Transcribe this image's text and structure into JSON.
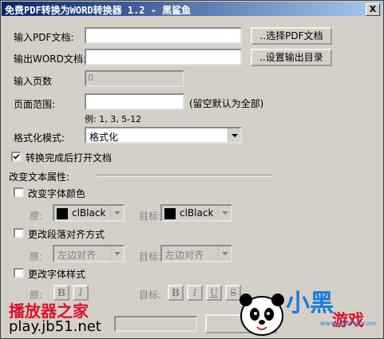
{
  "window": {
    "title": "免费PDF转换为WORD转换器 1.2 -  黑鲨鱼",
    "close_label": "X"
  },
  "form": {
    "input_pdf_label": "输入PDF文档:",
    "input_pdf_value": "",
    "choose_pdf_button": "..选择PDF文档",
    "output_word_label": "输出WORD文档:",
    "output_word_value": "",
    "set_output_button": "..设置输出目录",
    "page_count_label": "输入页数",
    "page_count_value": "0",
    "page_range_label": "页面范围:",
    "page_range_value": "",
    "page_range_hint": "(留空默认为全部)",
    "page_range_example": "例: 1, 3, 5-12",
    "format_mode_label": "格式化模式:",
    "format_mode_value": "格式化",
    "open_after_label": "转换完成后打开文档",
    "open_after_checked": true
  },
  "text_props": {
    "section_label": "改变文本属性:",
    "change_color_label": "改变字体颜色",
    "original_label": "原:",
    "target_label": "目标:",
    "original_color": "clBlack",
    "target_color": "clBlack",
    "change_align_label": "更改段落对齐方式",
    "original_align": "左边对齐",
    "target_align": "左边对齐",
    "change_style_label": "更改字体样式",
    "bold": "B",
    "italic": "I",
    "underline": "U",
    "strike": "S"
  },
  "watermark": {
    "site_name": "播放器之家",
    "site_url": "play.jb51.net",
    "brand": "小黑游戏",
    "brand_url": "www.xiaohei.com"
  },
  "colors": {
    "title_start": "#0a246a",
    "title_end": "#a6caf0",
    "site_red": "#e0102a",
    "brand_blue": "#1f7ad8"
  }
}
